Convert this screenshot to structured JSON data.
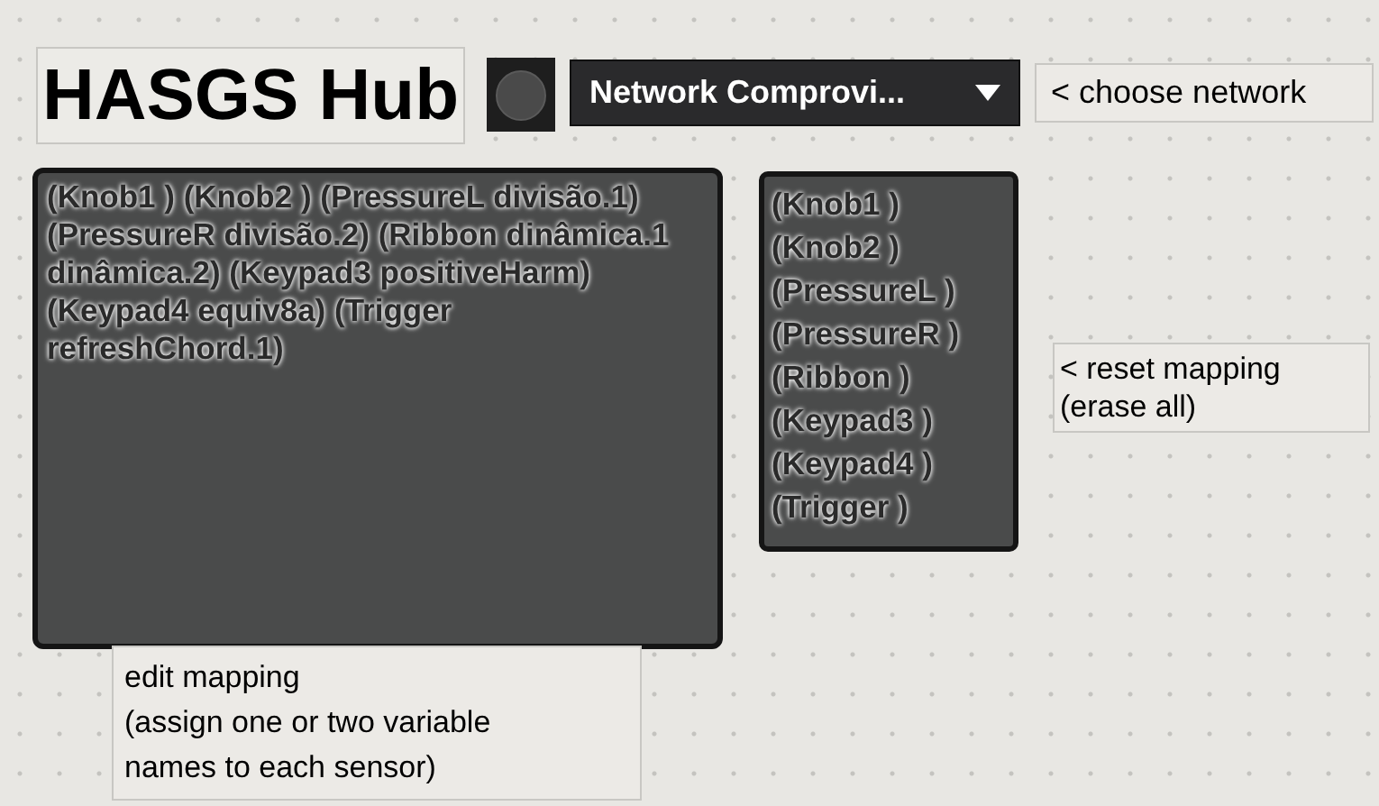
{
  "title": "HASGS Hub",
  "network_menu": {
    "value": "Network Comprovi..."
  },
  "choose_comment": "< choose network",
  "mapping_editor": {
    "text": "(Knob1 ) (Knob2 ) (PressureL divisão.1) (PressureR divisão.2) (Ribbon dinâmica.1 dinâmica.2) (Keypad3 positiveHarm) (Keypad4 equiv8a) (Trigger refreshChord.1)"
  },
  "reset_list": [
    "(Knob1 )",
    "(Knob2 )",
    "(PressureL )",
    "(PressureR )",
    "(Ribbon )",
    "(Keypad3 )",
    "(Keypad4 )",
    "(Trigger )"
  ],
  "reset_comment": [
    "< reset mapping",
    "(erase all)"
  ],
  "edit_comment": [
    "edit mapping",
    "(assign one or two variable",
    "names to each sensor)"
  ]
}
